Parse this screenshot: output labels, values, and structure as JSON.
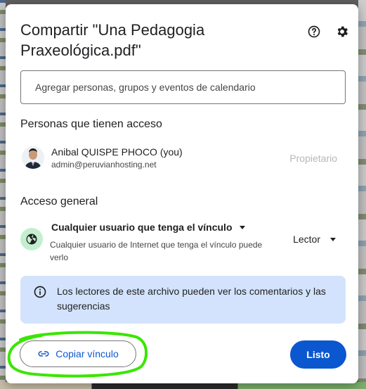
{
  "dialog": {
    "title": "Compartir \"Una Pedagogia Praxeológica.pdf\"",
    "help_icon": "help-circle-icon",
    "settings_icon": "gear-icon"
  },
  "add_people": {
    "placeholder": "Agregar personas, grupos y eventos de calendario"
  },
  "people_access": {
    "heading": "Personas que tienen acceso",
    "people": [
      {
        "name": "Anibal QUISPE PHOCO (you)",
        "email": "admin@peruvianhosting.net",
        "role": "Propietario"
      }
    ]
  },
  "general_access": {
    "heading": "Acceso general",
    "selected": "Cualquier usuario que tenga el vínculo",
    "description": "Cualquier usuario de Internet que tenga el vínculo puede verlo",
    "role": "Lector",
    "icon": "globe-icon"
  },
  "info": {
    "text": "Los lectores de este archivo pueden ver los comentarios y las sugerencias"
  },
  "footer": {
    "copy_link_label": "Copiar vínculo",
    "done_label": "Listo"
  },
  "colors": {
    "primary": "#0b57d0",
    "info_bg": "#d3e3fd",
    "globe_bg": "#c4eed0",
    "annotation": "#39e600"
  }
}
